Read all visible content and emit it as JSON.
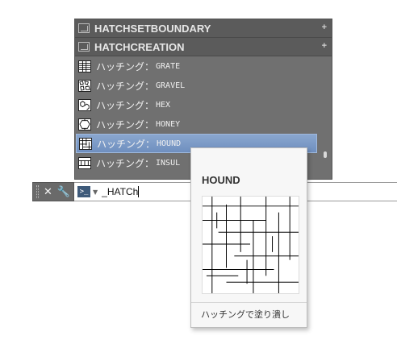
{
  "dropdown": {
    "header_items": [
      {
        "label": "HATCHSETBOUNDARY",
        "icon": "hatch-boundary-icon"
      },
      {
        "label": "HATCHCREATION",
        "icon": "hatch-create-icon"
      }
    ],
    "items": [
      {
        "prefix": "ハッチング：",
        "name": "GRATE"
      },
      {
        "prefix": "ハッチング：",
        "name": "GRAVEL"
      },
      {
        "prefix": "ハッチング：",
        "name": "HEX"
      },
      {
        "prefix": "ハッチング：",
        "name": "HONEY"
      },
      {
        "prefix": "ハッチング：",
        "name": "HOUND",
        "selected": true
      },
      {
        "prefix": "ハッチング：",
        "name": "INSUL"
      }
    ],
    "colors": {
      "background": "#707070",
      "selected": "#7a99c6"
    }
  },
  "command_line": {
    "close_icon": "close-icon",
    "customize_icon": "wrench-icon",
    "prompt_icon": "command-prompt-icon",
    "input_value": "_HATCh"
  },
  "tooltip": {
    "title": "HOUND",
    "footer": "ハッチングで塗り潰し"
  }
}
